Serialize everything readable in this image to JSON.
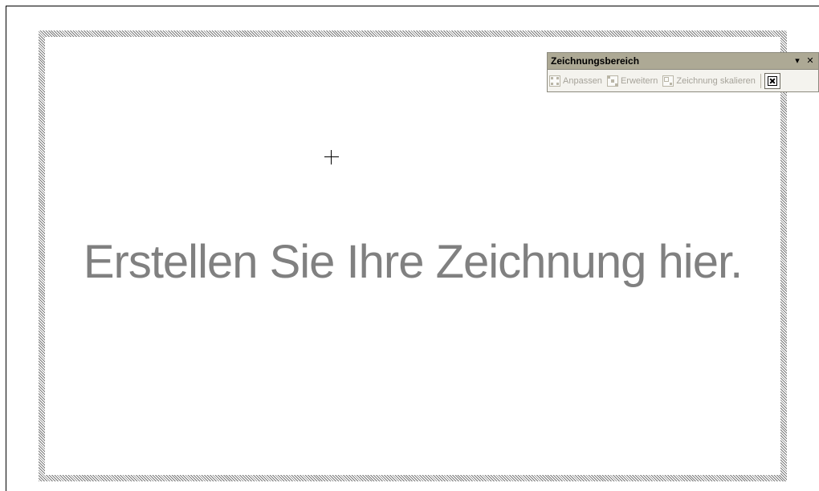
{
  "canvas": {
    "placeholder_text": "Erstellen Sie Ihre Zeichnung hier."
  },
  "toolbar": {
    "title": "Zeichnungsbereich",
    "dropdown_glyph": "▾",
    "close_glyph": "✕",
    "buttons": [
      {
        "label": "Anpassen",
        "icon": "fit-drawing-icon",
        "enabled": false
      },
      {
        "label": "Erweitern",
        "icon": "expand-drawing-icon",
        "enabled": false
      },
      {
        "label": "Zeichnung skalieren",
        "icon": "scale-drawing-icon",
        "enabled": false
      }
    ],
    "text_wrapping_icon": "text-wrapping-icon"
  },
  "colors": {
    "placeholder_text": "#808080",
    "toolbar_title_bar": "#ada995",
    "disabled_label": "#a6a39a"
  }
}
